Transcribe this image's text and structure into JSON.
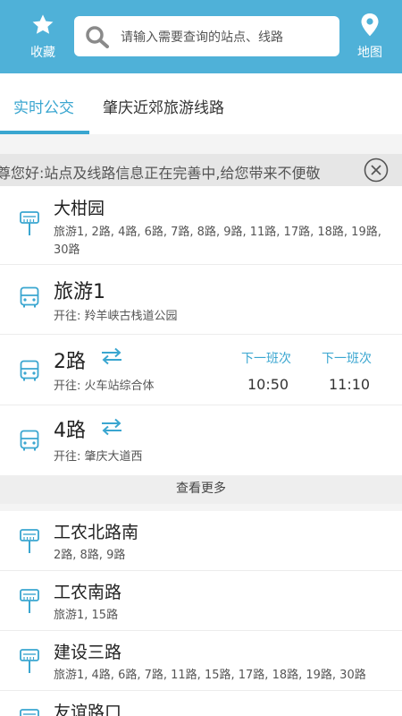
{
  "header": {
    "favorites_label": "收藏",
    "map_label": "地图",
    "search_placeholder": "请输入需要查询的站点、线路",
    "bg_color": "#4fb1d8"
  },
  "tabs": [
    {
      "label": "实时公交",
      "active": true
    },
    {
      "label": "肇庆近郊旅游线路",
      "active": false
    }
  ],
  "notice": {
    "text": "尊您好:站点及线路信息正在完善中,给您带来不便敬"
  },
  "nearby": [
    {
      "type": "station",
      "icon": "bus-stop-icon",
      "name": "大柑园",
      "lines": "旅游1, 2路, 4路, 6路, 7路, 8路, 9路, 11路, 17路, 18路, 19路, 30路"
    },
    {
      "type": "route",
      "icon": "bus-icon",
      "name": "旅游1",
      "direction": "开往: 羚羊峡古栈道公园"
    },
    {
      "type": "route",
      "icon": "bus-icon",
      "name": "2路",
      "direction": "开往: 火车站综合体",
      "next1_label": "下一班次",
      "next1_time": "10:50",
      "next2_label": "下一班次",
      "next2_time": "11:10"
    },
    {
      "type": "route",
      "icon": "bus-icon",
      "name": "4路",
      "direction": "开往: 肇庆大道西"
    }
  ],
  "more_label": "查看更多",
  "stations": [
    {
      "name": "工农北路南",
      "lines": "2路, 8路, 9路"
    },
    {
      "name": "工农南路",
      "lines": "旅游1, 15路"
    },
    {
      "name": "建设三路",
      "lines": "旅游1, 4路, 6路, 7路, 11路, 15路, 17路, 18路, 19路, 30路"
    },
    {
      "name": "友谊路口",
      "lines": ""
    }
  ],
  "accent_color": "#3aa6d0"
}
